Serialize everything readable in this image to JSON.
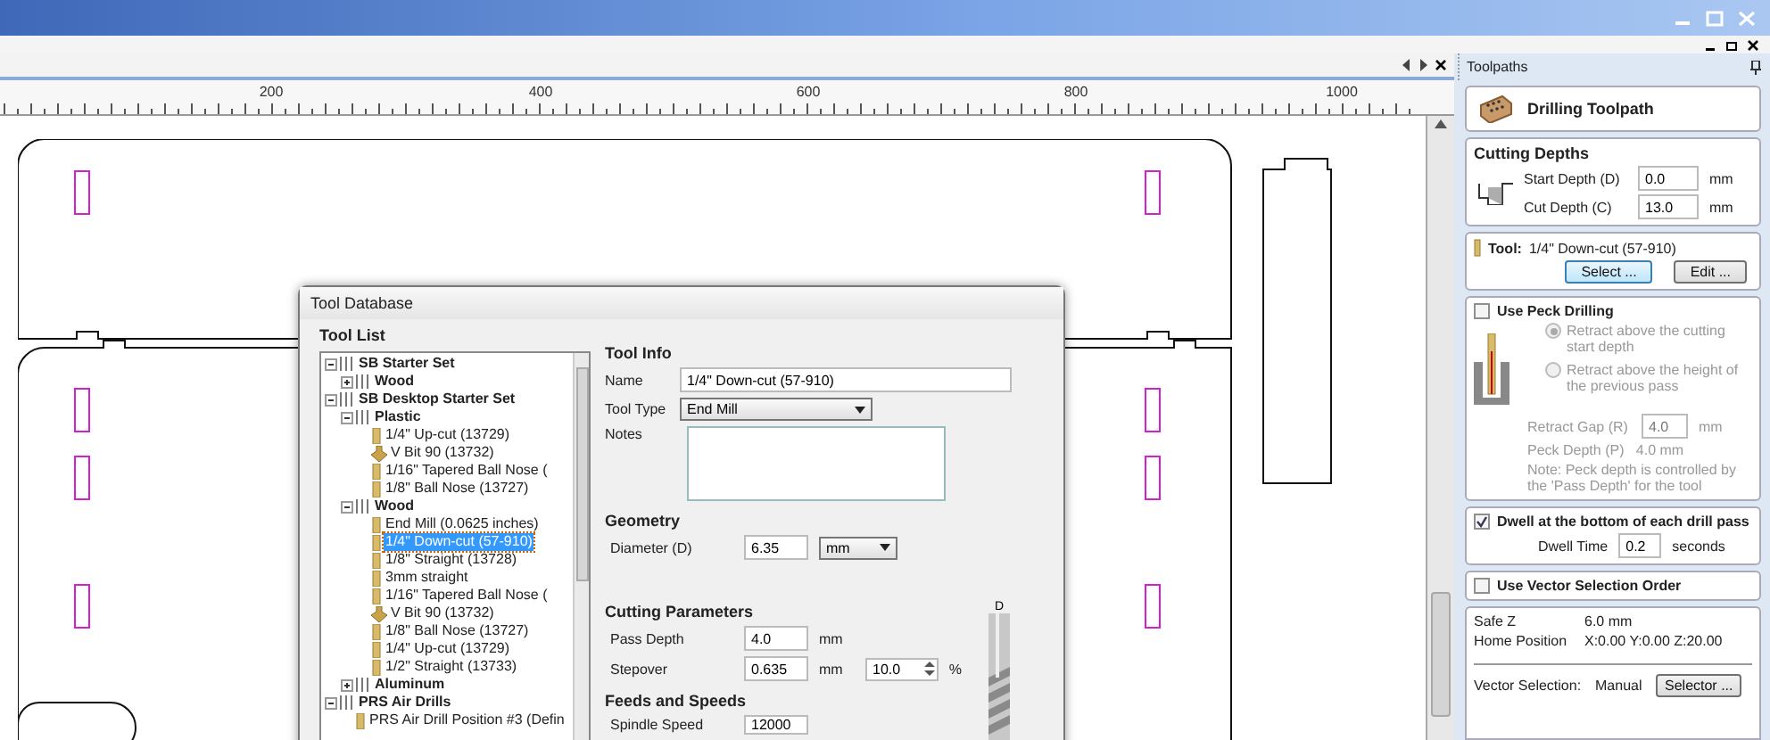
{
  "document": {
    "ruler_labels": [
      "200",
      "400",
      "600",
      "800",
      "1000"
    ]
  },
  "tool_database": {
    "title": "Tool Database",
    "tool_list_label": "Tool List",
    "tree": [
      {
        "label": "SB Starter Set",
        "kind": "group",
        "expanded": true,
        "selected": false,
        "children": [
          {
            "label": "Wood",
            "kind": "group",
            "expanded": false,
            "selected": false
          }
        ]
      },
      {
        "label": "SB Desktop Starter Set",
        "kind": "group",
        "expanded": true,
        "selected": false,
        "children": [
          {
            "label": "Plastic",
            "kind": "group",
            "expanded": true,
            "selected": false,
            "children": [
              {
                "label": "1/4\" Up-cut (13729)",
                "kind": "mill",
                "selected": false
              },
              {
                "label": "V Bit 90 (13732)",
                "kind": "vbit",
                "selected": false
              },
              {
                "label": "1/16\" Tapered Ball Nose (",
                "kind": "mill",
                "selected": false
              },
              {
                "label": "1/8\" Ball Nose (13727)",
                "kind": "mill",
                "selected": false
              }
            ]
          },
          {
            "label": "Wood",
            "kind": "group",
            "expanded": true,
            "selected": false,
            "children": [
              {
                "label": "End Mill (0.0625 inches)",
                "kind": "mill",
                "selected": false
              },
              {
                "label": "1/4\" Down-cut (57-910)",
                "kind": "mill",
                "selected": true
              },
              {
                "label": "1/8\" Straight (13728)",
                "kind": "mill",
                "selected": false
              },
              {
                "label": "3mm straight",
                "kind": "mill",
                "selected": false
              },
              {
                "label": "1/16\" Tapered Ball Nose (",
                "kind": "mill",
                "selected": false
              },
              {
                "label": "V Bit 90 (13732)",
                "kind": "vbit",
                "selected": false
              },
              {
                "label": "1/8\" Ball Nose (13727)",
                "kind": "mill",
                "selected": false
              },
              {
                "label": "1/4\" Up-cut (13729)",
                "kind": "mill",
                "selected": false
              },
              {
                "label": "1/2\" Straight (13733)",
                "kind": "mill",
                "selected": false
              }
            ]
          },
          {
            "label": "Aluminum",
            "kind": "group",
            "expanded": false,
            "selected": false
          }
        ]
      },
      {
        "label": "PRS Air Drills",
        "kind": "group",
        "expanded": true,
        "selected": false,
        "children": [
          {
            "label": "PRS Air Drill Position #3 (Defin",
            "kind": "mill",
            "selected": false
          }
        ]
      }
    ],
    "tool_info": {
      "heading": "Tool Info",
      "name_label": "Name",
      "name": "1/4\" Down-cut (57-910)",
      "type_label": "Tool Type",
      "type": "End Mill",
      "notes_label": "Notes"
    },
    "geometry": {
      "heading": "Geometry",
      "diameter_label": "Diameter (D)",
      "diameter": "6.35",
      "unit": "mm",
      "bit_marker": "D"
    },
    "cutting": {
      "heading": "Cutting Parameters",
      "pass_depth_label": "Pass Depth",
      "pass_depth": "4.0",
      "pass_depth_unit": "mm",
      "stepover_label": "Stepover",
      "stepover": "0.635",
      "stepover_unit": "mm",
      "stepover_percent": "10.0",
      "percent_unit": "%"
    },
    "feeds": {
      "heading": "Feeds and Speeds",
      "spindle_label": "Spindle Speed",
      "spindle": "12000"
    }
  },
  "toolpaths": {
    "title": "Toolpaths",
    "toolpath_name": "Drilling Toolpath",
    "cutting_depths": {
      "heading": "Cutting Depths",
      "start_label": "Start Depth (D)",
      "start": "0.0",
      "start_unit": "mm",
      "cut_label": "Cut Depth (C)",
      "cut": "13.0",
      "cut_unit": "mm"
    },
    "tool": {
      "label": "Tool:",
      "name": "1/4\" Down-cut (57-910)",
      "select_button": "Select ...",
      "edit_button": "Edit ..."
    },
    "peck": {
      "label": "Use Peck Drilling",
      "checked": false,
      "options": [
        {
          "label": "Retract above the cutting start depth",
          "selected": true
        },
        {
          "label": "Retract above the height of the previous pass",
          "selected": false
        }
      ],
      "gap_label": "Retract Gap (R)",
      "gap": "4.0",
      "gap_unit": "mm",
      "depth_text": "Peck Depth (P)   4.0 mm",
      "note": "Note: Peck depth is controlled by the 'Pass Depth' for the tool"
    },
    "dwell": {
      "label": "Dwell at the bottom of each drill pass",
      "checked": true,
      "time_label": "Dwell Time",
      "time": "0.2",
      "time_unit": "seconds"
    },
    "vector_order": {
      "label": "Use Vector Selection Order",
      "checked": false
    },
    "info": {
      "safe_z_label": "Safe Z",
      "safe_z": "6.0 mm",
      "home_label": "Home Position",
      "home": "X:0.00 Y:0.00 Z:20.00",
      "vector_label": "Vector Selection:",
      "vector_value": "Manual",
      "selector_button": "Selector ..."
    }
  }
}
